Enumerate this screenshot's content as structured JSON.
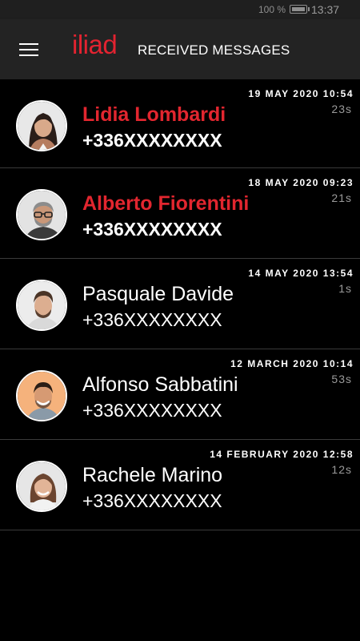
{
  "status_bar": {
    "battery": "100 %",
    "time": "13:37"
  },
  "header": {
    "logo": "iliad",
    "title": "RECEIVED MESSAGES"
  },
  "colors": {
    "accent": "#e32330",
    "background": "#000000",
    "app_bar": "#232323"
  },
  "messages": [
    {
      "name": "Lidia Lombardi",
      "number": "+336XXXXXXXX",
      "date": "19 MAY 2020 10:54",
      "duration": "23s",
      "unread": true
    },
    {
      "name": "Alberto Fiorentini",
      "number": "+336XXXXXXXX",
      "date": "18 MAY 2020 09:23",
      "duration": "21s",
      "unread": true
    },
    {
      "name": "Pasquale Davide",
      "number": "+336XXXXXXXX",
      "date": "14 MAY 2020 13:54",
      "duration": "1s",
      "unread": false
    },
    {
      "name": "Alfonso Sabbatini",
      "number": "+336XXXXXXXX",
      "date": "12 MARCH 2020 10:14",
      "duration": "53s",
      "unread": false
    },
    {
      "name": "Rachele Marino",
      "number": "+336XXXXXXXX",
      "date": "14 FEBRUARY 2020 12:58",
      "duration": "12s",
      "unread": false
    }
  ]
}
